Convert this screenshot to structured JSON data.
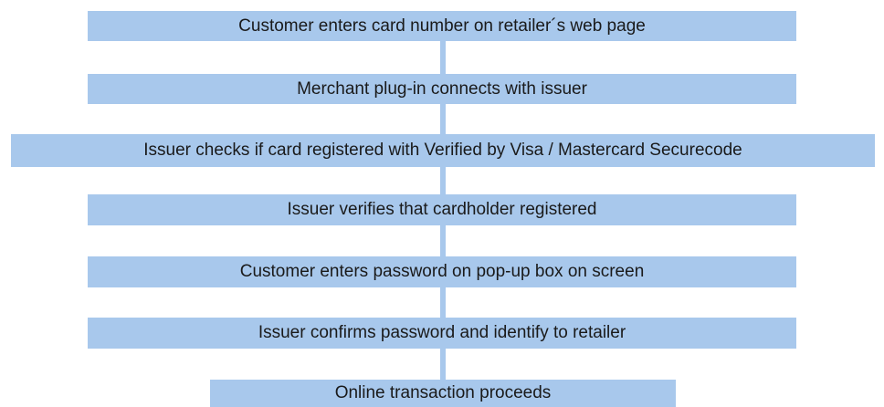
{
  "flow": {
    "steps": [
      "Customer enters card number on retailer´s web page",
      "Merchant plug-in connects with issuer",
      "Issuer checks if card registered with Verified by Visa / Mastercard Securecode",
      "Issuer verifies that cardholder registered",
      "Customer enters password on pop-up box on screen",
      "Issuer confirms password and identify to retailer",
      "Online transaction proceeds"
    ]
  },
  "colors": {
    "box_fill": "#a8c8ec",
    "text": "#1a1a1a"
  }
}
